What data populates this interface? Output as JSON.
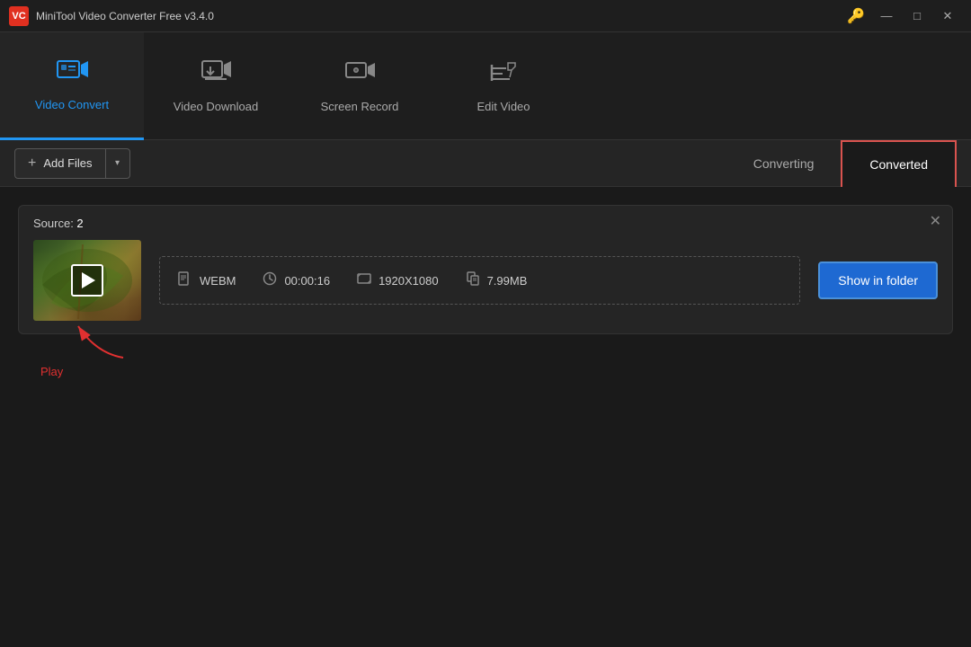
{
  "titlebar": {
    "logo_text": "VC",
    "title": "MiniTool Video Converter Free v3.4.0",
    "controls": {
      "minimize": "—",
      "maximize": "□",
      "close": "✕"
    }
  },
  "navbar": {
    "items": [
      {
        "id": "video-convert",
        "label": "Video Convert",
        "icon": "⬛▶",
        "active": true
      },
      {
        "id": "video-download",
        "label": "Video Download",
        "icon": "⬇"
      },
      {
        "id": "screen-record",
        "label": "Screen Record",
        "icon": "▶"
      },
      {
        "id": "edit-video",
        "label": "Edit Video",
        "icon": "✂"
      }
    ]
  },
  "toolbar": {
    "add_files_label": "Add Files",
    "converting_tab": "Converting",
    "converted_tab": "Converted"
  },
  "file_card": {
    "source_label": "Source:",
    "source_count": " 2",
    "format": "WEBM",
    "duration": "00:00:16",
    "resolution": "1920X1080",
    "filesize": "7.99MB",
    "show_folder_btn": "Show in folder",
    "play_annotation": "Play"
  }
}
